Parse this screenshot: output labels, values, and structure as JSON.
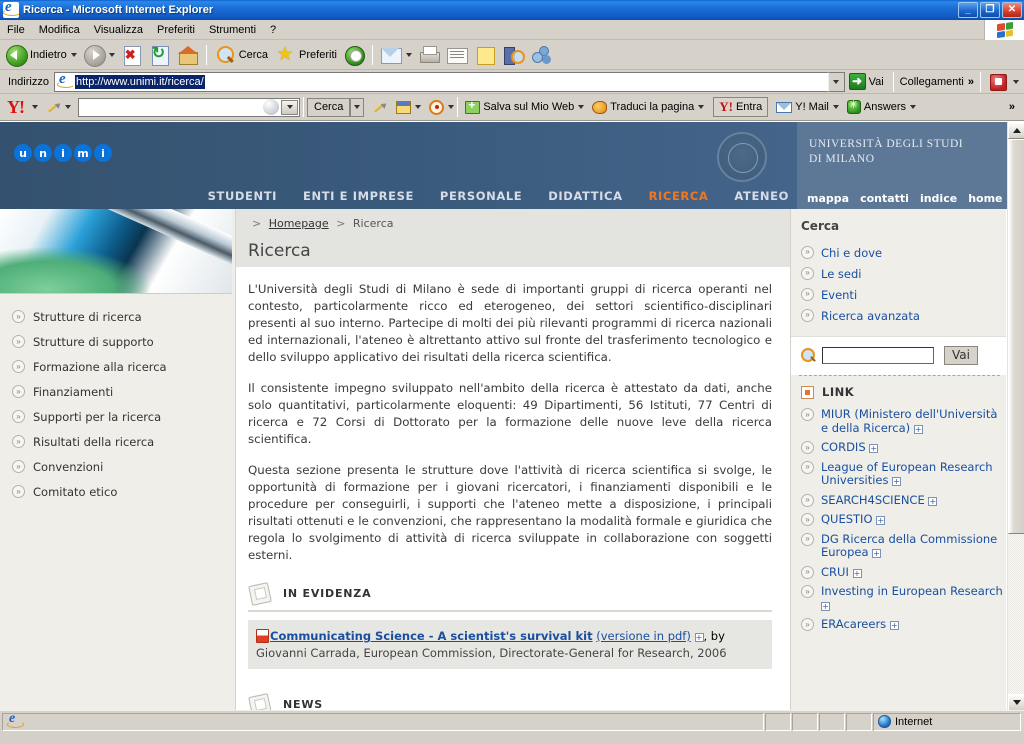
{
  "window": {
    "title": "Ricerca - Microsoft Internet Explorer",
    "minimize_label": "_",
    "maximize_label": "❐",
    "close_label": "✕"
  },
  "menubar": {
    "items": [
      {
        "label": "File",
        "accel": "F"
      },
      {
        "label": "Modifica",
        "accel": "M"
      },
      {
        "label": "Visualizza",
        "accel": "V"
      },
      {
        "label": "Preferiti",
        "accel": "P"
      },
      {
        "label": "Strumenti",
        "accel": "S"
      },
      {
        "label": "?",
        "accel": ""
      }
    ]
  },
  "toolbar": {
    "back_label": "Indietro",
    "search_label": "Cerca",
    "favorites_label": "Preferiti",
    "icons": [
      "back-icon",
      "forward-icon",
      "stop-icon",
      "refresh-icon",
      "home-icon",
      "search-icon",
      "favorites-icon",
      "history-icon",
      "mail-icon",
      "print-icon",
      "edit-icon",
      "note-icon",
      "research-icon",
      "messenger-icon"
    ]
  },
  "address_bar": {
    "label": "Indirizzo",
    "url": "http://www.unimi.it/ricerca/",
    "go_label": "Vai",
    "links_label": "Collegamenti",
    "overflow_label": "»"
  },
  "yahoo_toolbar": {
    "logo": "Y!",
    "search_value": "",
    "search_button": "Cerca",
    "items": [
      {
        "label": "Salva sul Mio Web",
        "icon": "folder-plus-icon"
      },
      {
        "label": "Traduci la pagina",
        "icon": "fish-icon"
      },
      {
        "label": "Entra",
        "icon": "yahoo-id-icon"
      },
      {
        "label": "Y! Mail",
        "icon": "envelope-icon"
      },
      {
        "label": "Answers",
        "icon": "answers-icon"
      }
    ],
    "overflow_label": "»"
  },
  "site": {
    "logo_letters": [
      "u",
      "n",
      "i",
      "m",
      "i"
    ],
    "university_name_line1": "UNIVERSITÀ DEGLI STUDI",
    "university_name_line2": "DI MILANO",
    "main_nav": [
      {
        "label": "STUDENTI",
        "active": false
      },
      {
        "label": "ENTI E IMPRESE",
        "active": false
      },
      {
        "label": "PERSONALE",
        "active": false
      },
      {
        "label": "DIDATTICA",
        "active": false
      },
      {
        "label": "RICERCA",
        "active": true
      },
      {
        "label": "ATENEO",
        "active": false
      }
    ],
    "top_links": [
      "mappa",
      "contatti",
      "indice",
      "home"
    ]
  },
  "breadcrumb": {
    "sep": ">",
    "home_label": "Homepage",
    "current_label": "Ricerca"
  },
  "page_title": "Ricerca",
  "left_nav": {
    "items": [
      "Strutture di ricerca",
      "Strutture di supporto",
      "Formazione alla ricerca",
      "Finanziamenti",
      "Supporti per la ricerca",
      "Risultati della ricerca",
      "Convenzioni",
      "Comitato etico"
    ]
  },
  "main": {
    "paragraphs": [
      "L'Università degli Studi di Milano è sede di importanti gruppi di ricerca operanti nel contesto, particolarmente ricco ed eterogeneo, dei settori scientifico-disciplinari presenti al suo interno. Partecipe di molti dei più rilevanti programmi di ricerca nazionali ed internazionali, l'ateneo è altrettanto attivo sul fronte del trasferimento tecnologico e dello sviluppo applicativo dei risultati della ricerca scientifica.",
      "Il consistente impegno sviluppato nell'ambito della ricerca è attestato da dati, anche solo quantitativi, particolarmente eloquenti: 49 Dipartimenti, 56 Istituti, 77 Centri di ricerca e 72 Corsi di Dottorato per la formazione delle nuove leve della ricerca scientifica.",
      "Questa sezione presenta le strutture dove l'attività di ricerca scientifica si svolge, le opportunità di formazione per i giovani ricercatori, i finanziamenti disponibili e le procedure per conseguirli, i supporti che l'ateneo mette a disposizione, i principali risultati ottenuti e le convenzioni, che rappresentano la modalità formale e giuridica che regola lo svolgimento di attività di ricerca sviluppate in collaborazione con soggetti esterni."
    ],
    "in_evidenza_heading": "IN EVIDENZA",
    "featured": {
      "title": "Communicating Science - A scientist's survival kit",
      "pdf_note": "(versione in pdf)",
      "external_marker": "+",
      "byline_prefix": ", by",
      "byline": "Giovanni Carrada, European Commission, Directorate-General for Research, 2006"
    },
    "news_heading": "NEWS"
  },
  "right_sidebar": {
    "cerca_heading": "Cerca",
    "cerca_links": [
      "Chi e dove",
      "Le sedi",
      "Eventi",
      "Ricerca avanzata"
    ],
    "search_value": "",
    "search_button": "Vai",
    "link_heading": "LINK",
    "links": [
      {
        "label": "MIUR (Ministero dell'Università e della Ricerca)",
        "external": true
      },
      {
        "label": "CORDIS",
        "external": true
      },
      {
        "label": "League of European Research Universities",
        "external": true
      },
      {
        "label": "SEARCH4SCIENCE",
        "external": true
      },
      {
        "label": "QUESTIO",
        "external": true
      },
      {
        "label": "DG Ricerca della Commissione Europea",
        "external": true
      },
      {
        "label": "CRUI",
        "external": true
      },
      {
        "label": "Investing in European Research",
        "external": true
      },
      {
        "label": "ERAcareers",
        "external": true
      }
    ],
    "external_marker": "+"
  },
  "statusbar": {
    "message": "",
    "zone": "Internet"
  },
  "colors": {
    "header_blue": "#3a5a7c",
    "header_right_blue": "#5d7896",
    "accent_orange": "#f07820",
    "link_blue": "#1a4fa0",
    "sidebar_bg": "#efeee8",
    "chrome_bg": "#d6d2ca"
  }
}
